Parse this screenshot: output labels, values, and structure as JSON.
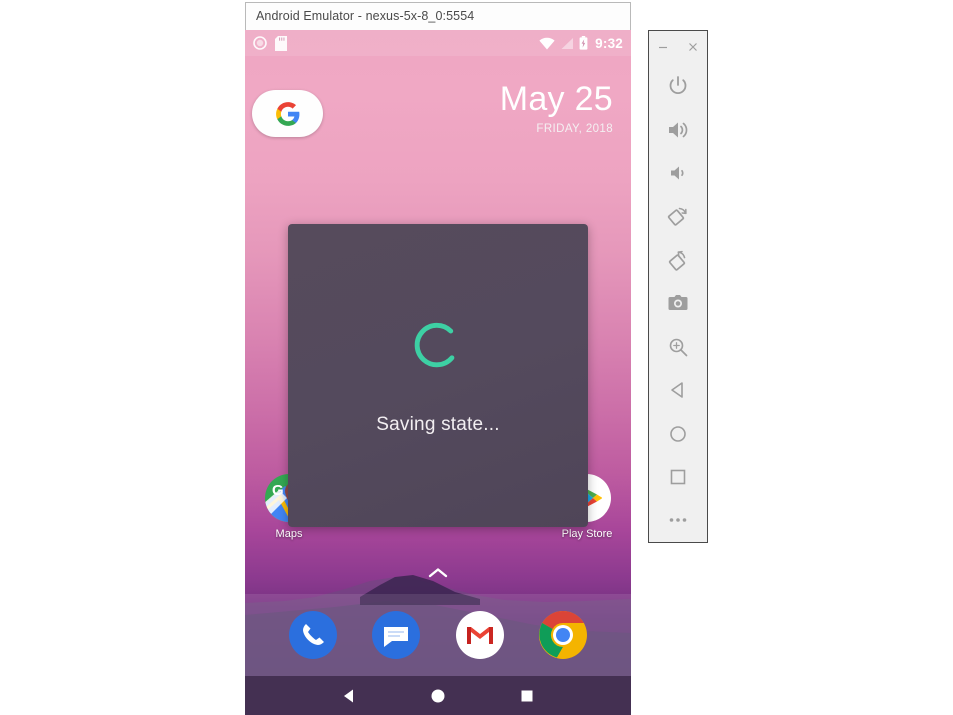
{
  "window": {
    "title": "Android Emulator - nexus-5x-8_0:5554"
  },
  "status_bar": {
    "clock": "9:32",
    "icons": [
      "screen-record-icon",
      "sd-card-icon",
      "wifi-icon",
      "cellular-signal-icon",
      "battery-charging-icon"
    ]
  },
  "home": {
    "search_widget": {
      "icon": "google-g-icon"
    },
    "date_widget": {
      "date": "May 25",
      "weekday_year": "FRIDAY, 2018"
    },
    "apps": [
      {
        "name": "Maps",
        "icon": "google-maps-icon"
      },
      {
        "name": "Play Store",
        "icon": "google-play-store-icon"
      }
    ],
    "app_drawer_hint": "chevron-up-icon",
    "dock": [
      {
        "name": "Phone",
        "icon": "phone-icon"
      },
      {
        "name": "Messages",
        "icon": "messages-icon"
      },
      {
        "name": "Gmail",
        "icon": "gmail-icon"
      },
      {
        "name": "Chrome",
        "icon": "chrome-icon"
      }
    ],
    "nav_bar": [
      {
        "name": "Back",
        "icon": "back-triangle-icon"
      },
      {
        "name": "Home",
        "icon": "home-circle-icon"
      },
      {
        "name": "Overview",
        "icon": "overview-square-icon"
      }
    ]
  },
  "dialog": {
    "message": "Saving state...",
    "spinner_color": "#3dd0a4"
  },
  "toolbar": {
    "window_controls": [
      {
        "name": "Minimize",
        "icon": "minimize-icon"
      },
      {
        "name": "Close",
        "icon": "close-icon"
      }
    ],
    "buttons": [
      {
        "name": "Power",
        "icon": "power-icon"
      },
      {
        "name": "Volume up",
        "icon": "volume-up-icon"
      },
      {
        "name": "Volume down",
        "icon": "volume-down-icon"
      },
      {
        "name": "Rotate left",
        "icon": "rotate-left-icon"
      },
      {
        "name": "Rotate right",
        "icon": "rotate-right-icon"
      },
      {
        "name": "Take screenshot",
        "icon": "camera-icon"
      },
      {
        "name": "Zoom",
        "icon": "zoom-in-icon"
      },
      {
        "name": "Back",
        "icon": "back-triangle-icon"
      },
      {
        "name": "Home",
        "icon": "home-circle-icon"
      },
      {
        "name": "Overview",
        "icon": "overview-square-icon"
      },
      {
        "name": "More",
        "icon": "more-ellipsis-icon"
      }
    ]
  },
  "colors": {
    "toolbar_icon": "#9e9e9e",
    "dialog_bg": "#544a5d",
    "nav_bar_bg": "#443052"
  }
}
